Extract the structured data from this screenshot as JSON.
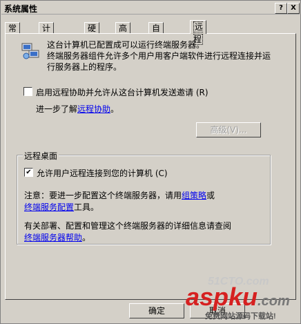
{
  "window": {
    "title": "系统属性"
  },
  "titlebar": {
    "help_glyph": "?",
    "close_glyph": "X"
  },
  "tabs": [
    {
      "label": "常规"
    },
    {
      "label": "计算机名"
    },
    {
      "label": "硬件"
    },
    {
      "label": "高级"
    },
    {
      "label": "自动更新"
    },
    {
      "label": "远程"
    }
  ],
  "intro": {
    "line1": "这台计算机已配置成可以运行终端服务器。",
    "line2": "终端服务器组件允许多个用户用客户端软件进行远程连接并运",
    "line3": "行服务器上的程序。"
  },
  "remote_assistance": {
    "checkbox_label": "启用远程协助并允许从这台计算机发送邀请",
    "shortcut": "(R)",
    "learn_prefix": "进一步了解",
    "learn_link": "远程协助",
    "learn_suffix": "。",
    "advanced_button": "高级(V)..."
  },
  "remote_desktop": {
    "group_title": "远程桌面",
    "checkbox_label": "允许用户远程连接到您的计算机",
    "checkbox_mark": "✔",
    "shortcut": "(C)",
    "note_prefix": "注意：要进一步配置这个终端服务器，请用",
    "note_link1": "组策略",
    "note_mid": "或",
    "note_link2": "终端服务配置",
    "note_suffix": "工具。",
    "more_prefix": "有关部署、配置和管理这个终端服务器的详细信息请查阅",
    "more_link": "终端服务器帮助",
    "more_suffix": "。"
  },
  "footer": {
    "ok_button": "确定",
    "cancel_button": "取消"
  },
  "watermark": {
    "site": "51CTO.com",
    "brand": "aspku",
    "brand_suffix": ".com",
    "tagline": "免费网站源码下载站!"
  }
}
